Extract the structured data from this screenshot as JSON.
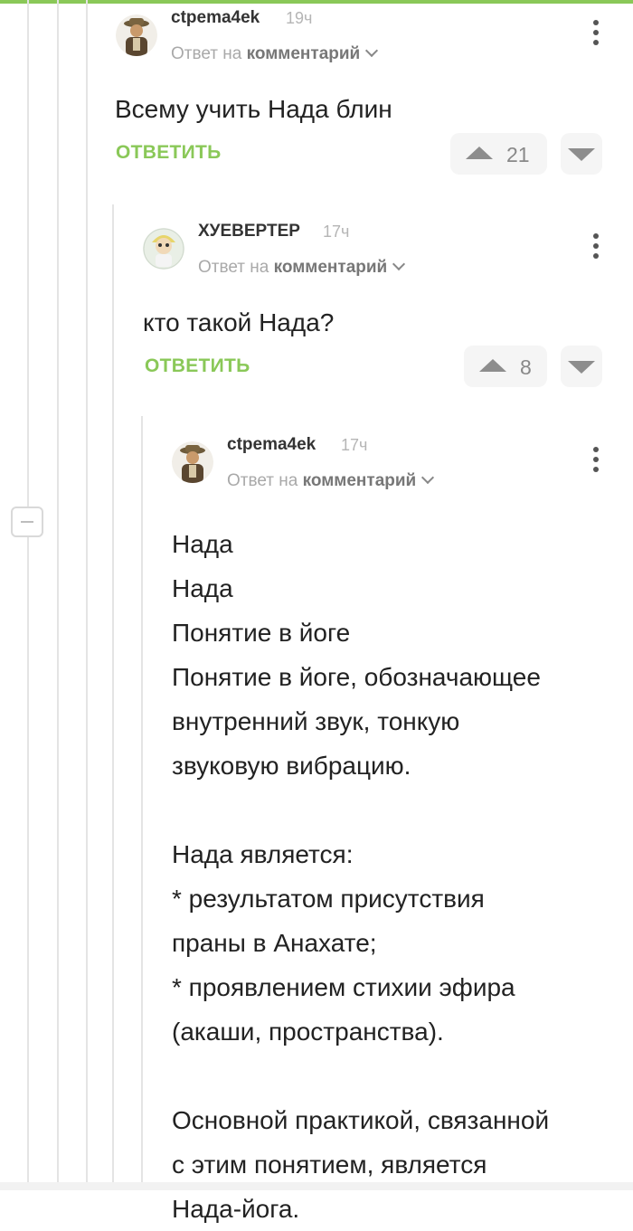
{
  "comments": [
    {
      "username": "ctpema4ek",
      "time": "19ч",
      "reply_prefix": "Ответ на",
      "reply_target": "комментарий",
      "text": "Всему учить Нада блин",
      "reply_label": "ОТВЕТИТЬ",
      "votes": "21"
    },
    {
      "username": "ХУЕВЕРТЕР",
      "time": "17ч",
      "reply_prefix": "Ответ на",
      "reply_target": "комментарий",
      "text": "кто такой Нада?",
      "reply_label": "ОТВЕТИТЬ",
      "votes": "8"
    },
    {
      "username": "ctpema4ek",
      "time": "17ч",
      "reply_prefix": "Ответ на",
      "reply_target": "комментарий",
      "lines": [
        "Нада",
        "Нада",
        "Понятие в йоге",
        "Понятие в йоге, обозначающее",
        "внутренний звук, тонкую",
        "звуковую вибрацию.",
        "",
        "Нада является:",
        "* результатом присутствия",
        "праны в Анахате;",
        "* проявлением стихии эфира",
        "(акаши, пространства).",
        "",
        "Основной практикой, связанной",
        "с этим понятием, является",
        "Нада-йога."
      ]
    }
  ],
  "colors": {
    "accent": "#8ac858",
    "thread_line": "#e4e4e4",
    "vote_bg": "#f5f5f5"
  },
  "icons": [
    "collapse-icon",
    "more-icon",
    "upvote-icon",
    "downvote-icon",
    "chevron-down-icon"
  ]
}
